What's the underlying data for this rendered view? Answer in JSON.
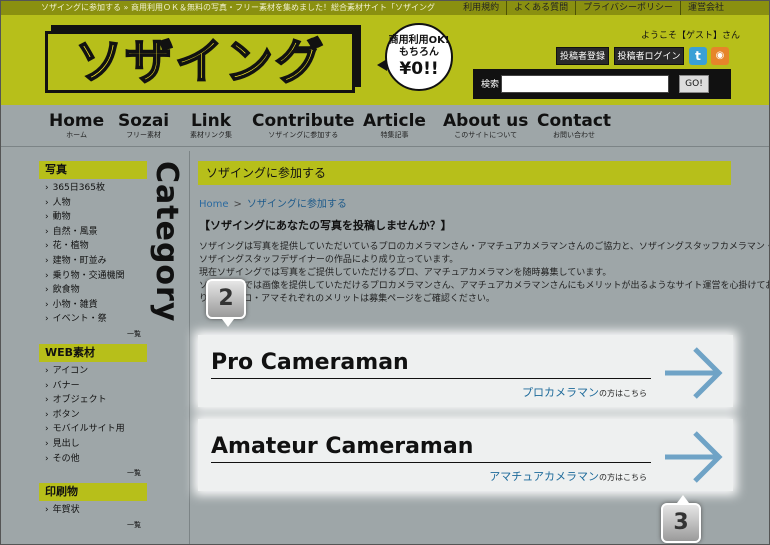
{
  "header": {
    "tagline": "ソザイングに参加する » 商用利用ＯＫ＆無料の写真・フリー素材を集めました！総合素材サイト「ソザイング",
    "top_links": [
      "利用規約",
      "よくある質問",
      "プライバシーポリシー",
      "運営会社"
    ],
    "logo_text": "ソザイング",
    "badge": {
      "line1": "商用利用OK!",
      "line2": "もちろん",
      "line3": "¥0!!"
    },
    "welcome": "ようこそ【ゲスト】さん",
    "register_label": "投稿者登録",
    "login_label": "投稿者ログイン",
    "twitter_glyph": "t",
    "rss_glyph": "◉",
    "search": {
      "label": "検索",
      "placeholder": "",
      "button": "GO!"
    },
    "colors": {
      "brand": "#b7bf1a",
      "logo_fill": "#ffef2a",
      "dark": "#111111"
    }
  },
  "nav": [
    {
      "en": "Home",
      "jp": "ホーム"
    },
    {
      "en": "Sozai",
      "jp": "フリー素材"
    },
    {
      "en": "Link",
      "jp": "素材リンク集"
    },
    {
      "en": "Contribute",
      "jp": "ソザイングに参加する"
    },
    {
      "en": "Article",
      "jp": "特集記事"
    },
    {
      "en": "About us",
      "jp": "このサイトについて"
    },
    {
      "en": "Contact",
      "jp": "お問い合わせ"
    }
  ],
  "sidebar": {
    "vertical_title": "Category",
    "more_label": "一覧",
    "sections": [
      {
        "title": "写真",
        "items": [
          "365日365枚",
          "人物",
          "動物",
          "自然・風景",
          "花・植物",
          "建物・町並み",
          "乗り物・交通機関",
          "飲食物",
          "小物・雑貨",
          "イベント・祭"
        ]
      },
      {
        "title": "WEB素材",
        "items": [
          "アイコン",
          "バナー",
          "オブジェクト",
          "ボタン",
          "モバイルサイト用",
          "見出し",
          "その他"
        ]
      },
      {
        "title": "印刷物",
        "items": [
          "年賀状"
        ]
      }
    ]
  },
  "main": {
    "section_title": "ソザイングに参加する",
    "breadcrumb": {
      "home": "Home",
      "sep": ">",
      "current": "ソザイングに参加する"
    },
    "heading": "【ソザイングにあなたの写真を投稿しませんか？】",
    "intro": [
      "ソザイングは写真を提供していただいているプロのカメラマンさん・アマチュアカメラマンさんのご協力と、ソザイングスタッフカメラマン・",
      "ソザイングスタッフデザイナーの作品により成り立っています。",
      "現在ソザイングでは写真をご提供していただけるプロ、アマチュアカメラマンを随時募集しています。",
      "ソザイングでは画像を提供していただけるプロカメラマンさん、アマチュアカメラマンさんにもメリットが出るようなサイト運営を心掛けてお",
      "ります。プロ・アマそれぞれのメリットは募集ページをご確認ください。"
    ],
    "cards": [
      {
        "title": "Pro Cameraman",
        "sub": "プロカメラマン",
        "sub_suffix": "の方はこちら"
      },
      {
        "title": "Amateur Cameraman",
        "sub": "アマチュアカメラマン",
        "sub_suffix": "の方はこちら"
      }
    ],
    "arrow_color": "#6fa3c6"
  },
  "markers": [
    "2",
    "3"
  ]
}
